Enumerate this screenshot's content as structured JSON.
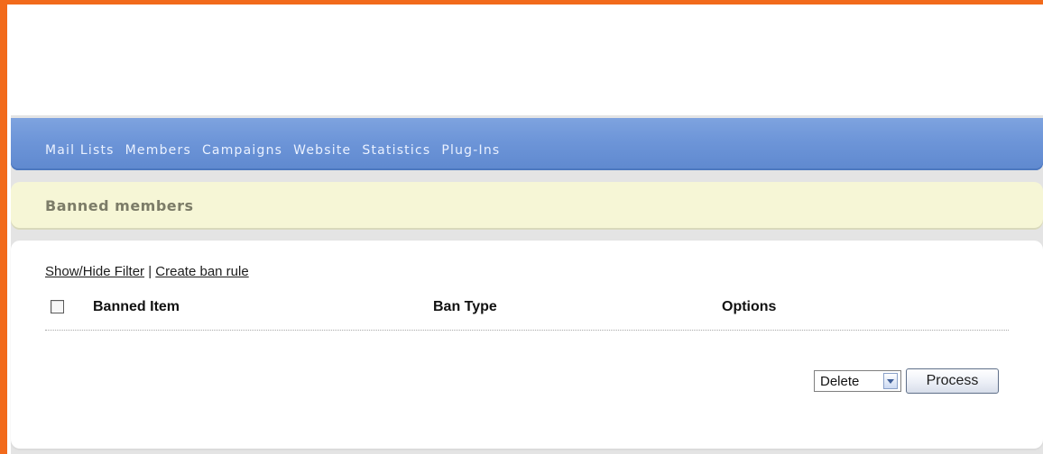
{
  "nav": {
    "items": [
      {
        "label": "Mail Lists"
      },
      {
        "label": "Members"
      },
      {
        "label": "Campaigns"
      },
      {
        "label": "Website"
      },
      {
        "label": "Statistics"
      },
      {
        "label": "Plug-Ins"
      }
    ]
  },
  "page": {
    "title": "Banned members"
  },
  "links": {
    "show_hide_filter": "Show/Hide Filter",
    "separator": " | ",
    "create_ban_rule": "Create ban rule"
  },
  "table": {
    "columns": [
      {
        "label": "Banned Item"
      },
      {
        "label": "Ban Type"
      },
      {
        "label": "Options"
      }
    ]
  },
  "actions": {
    "selected_action": "Delete",
    "process_label": "Process"
  },
  "colors": {
    "frame_accent": "#f26a1b",
    "nav_blue": "#6d95d8",
    "title_bg": "#f6f6d6"
  },
  "icons": {
    "dropdown": "chevron-down-icon"
  }
}
